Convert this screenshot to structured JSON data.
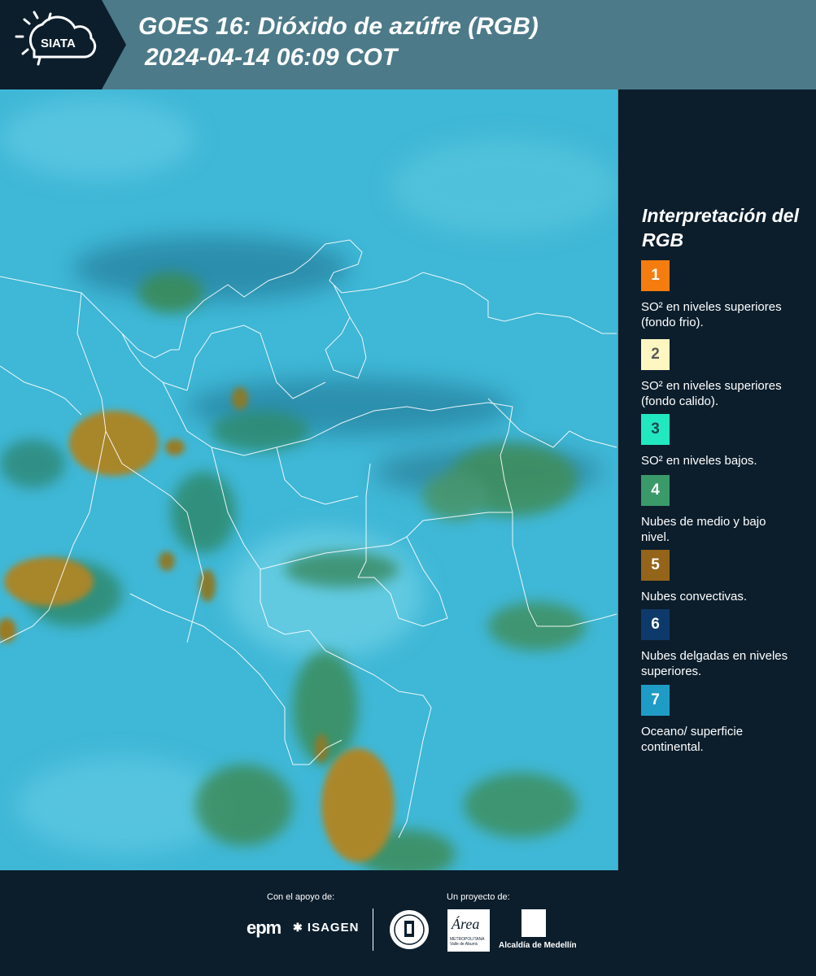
{
  "header": {
    "logo_text": "SIATA",
    "title_line1": "GOES 16: Dióxido de azúfre (RGB)",
    "title_line2": "2024-04-14 06:09 COT",
    "background_color": "#4c7a89"
  },
  "legend": {
    "title": "Interpretación del RGB",
    "items": [
      {
        "number": "1",
        "color": "#f57c0e",
        "number_color": "#ffffff",
        "label": "SO² en niveles superiores (fondo frio)."
      },
      {
        "number": "2",
        "color": "#fff7c2",
        "number_color": "#5a5a5a",
        "label": "SO² en niveles superiores (fondo calido)."
      },
      {
        "number": "3",
        "color": "#22e8c0",
        "number_color": "#1a4a52",
        "label": "SO² en niveles bajos."
      },
      {
        "number": "4",
        "color": "#3a9a6a",
        "number_color": "#ffffff",
        "label": "Nubes de medio y bajo nivel."
      },
      {
        "number": "5",
        "color": "#94641a",
        "number_color": "#ffffff",
        "label": "Nubes convectivas."
      },
      {
        "number": "6",
        "color": "#0d3a6a",
        "number_color": "#ffffff",
        "label": "Nubes delgadas en niveles superiores."
      },
      {
        "number": "7",
        "color": "#1f9cc6",
        "number_color": "#ffffff",
        "label": "Oceano/ superficie continental."
      }
    ]
  },
  "footer": {
    "support_label": "Con el apoyo de:",
    "project_label": "Un proyecto de:",
    "sponsors": [
      "epm",
      "ISAGEN"
    ],
    "area_logo_text": "Área",
    "area_logo_subtext": "METROPOLITANA Valle de Aburrá",
    "partner": "Alcaldía de Medellín"
  },
  "map": {
    "ocean_color": "#3fb7d6",
    "cloud_colors": [
      "#2f9a8a",
      "#4a8a3a",
      "#a8862a",
      "#1f6e84"
    ]
  }
}
